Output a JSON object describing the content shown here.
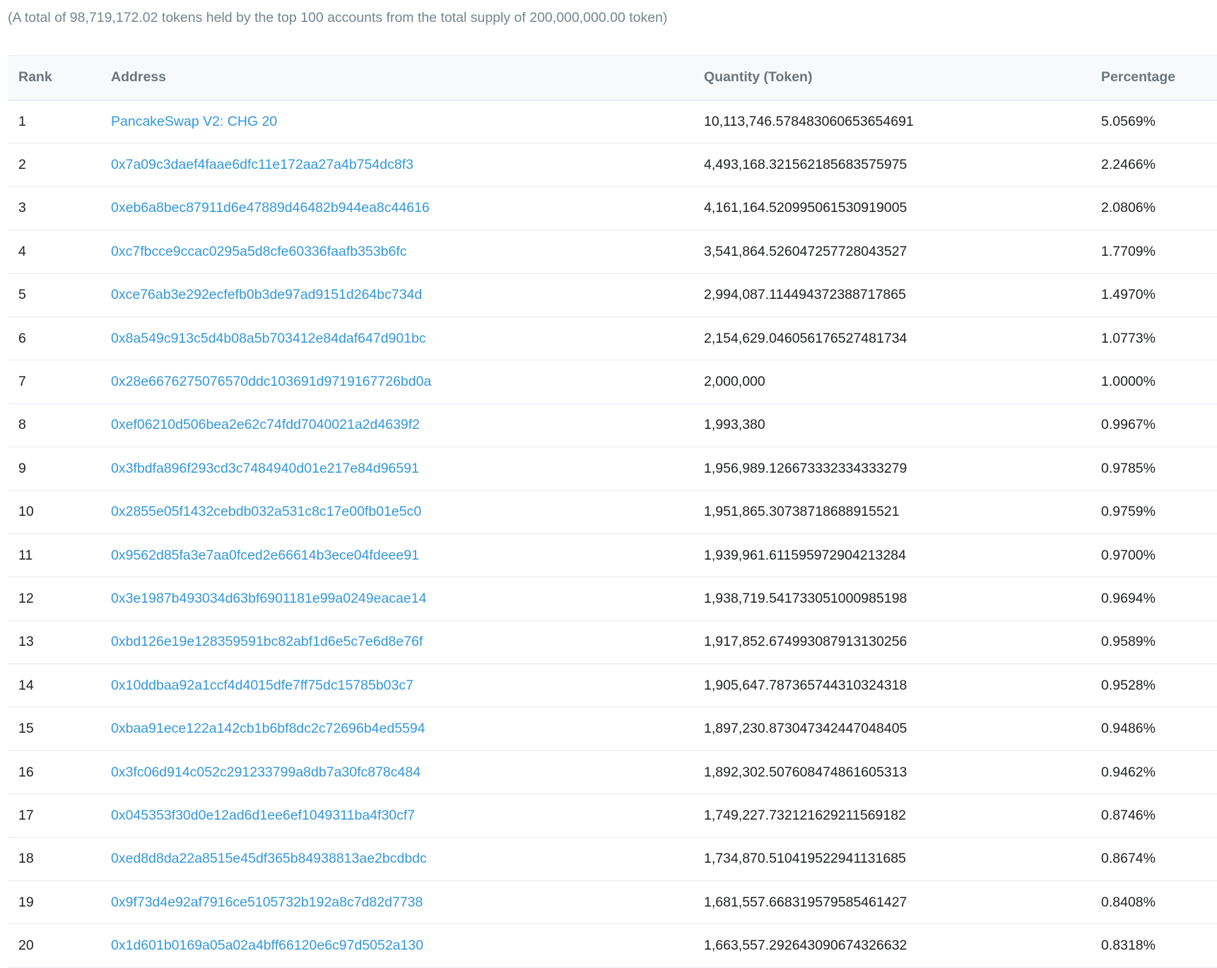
{
  "summary": "(A total of 98,719,172.02 tokens held by the top 100 accounts from the total supply of 200,000,000.00 token)",
  "columns": {
    "rank": "Rank",
    "address": "Address",
    "quantity": "Quantity (Token)",
    "percentage": "Percentage"
  },
  "colors": {
    "link": "#3498db",
    "header_bg": "#f8f9fa",
    "muted_text": "#77838f",
    "border": "#e7eaf3"
  },
  "rows": [
    {
      "rank": "1",
      "address": "PancakeSwap V2: CHG 20",
      "quantity": "10,113,746.578483060653654691",
      "percentage": "5.0569%"
    },
    {
      "rank": "2",
      "address": "0x7a09c3daef4faae6dfc11e172aa27a4b754dc8f3",
      "quantity": "4,493,168.321562185683575975",
      "percentage": "2.2466%"
    },
    {
      "rank": "3",
      "address": "0xeb6a8bec87911d6e47889d46482b944ea8c44616",
      "quantity": "4,161,164.520995061530919005",
      "percentage": "2.0806%"
    },
    {
      "rank": "4",
      "address": "0xc7fbcce9ccac0295a5d8cfe60336faafb353b6fc",
      "quantity": "3,541,864.526047257728043527",
      "percentage": "1.7709%"
    },
    {
      "rank": "5",
      "address": "0xce76ab3e292ecfefb0b3de97ad9151d264bc734d",
      "quantity": "2,994,087.114494372388717865",
      "percentage": "1.4970%"
    },
    {
      "rank": "6",
      "address": "0x8a549c913c5d4b08a5b703412e84daf647d901bc",
      "quantity": "2,154,629.046056176527481734",
      "percentage": "1.0773%"
    },
    {
      "rank": "7",
      "address": "0x28e6676275076570ddc103691d9719167726bd0a",
      "quantity": "2,000,000",
      "percentage": "1.0000%"
    },
    {
      "rank": "8",
      "address": "0xef06210d506bea2e62c74fdd7040021a2d4639f2",
      "quantity": "1,993,380",
      "percentage": "0.9967%"
    },
    {
      "rank": "9",
      "address": "0x3fbdfa896f293cd3c7484940d01e217e84d96591",
      "quantity": "1,956,989.126673332334333279",
      "percentage": "0.9785%"
    },
    {
      "rank": "10",
      "address": "0x2855e05f1432cebdb032a531c8c17e00fb01e5c0",
      "quantity": "1,951,865.30738718688915521",
      "percentage": "0.9759%"
    },
    {
      "rank": "11",
      "address": "0x9562d85fa3e7aa0fced2e66614b3ece04fdeee91",
      "quantity": "1,939,961.611595972904213284",
      "percentage": "0.9700%"
    },
    {
      "rank": "12",
      "address": "0x3e1987b493034d63bf6901181e99a0249eacae14",
      "quantity": "1,938,719.541733051000985198",
      "percentage": "0.9694%"
    },
    {
      "rank": "13",
      "address": "0xbd126e19e128359591bc82abf1d6e5c7e6d8e76f",
      "quantity": "1,917,852.674993087913130256",
      "percentage": "0.9589%"
    },
    {
      "rank": "14",
      "address": "0x10ddbaa92a1ccf4d4015dfe7ff75dc15785b03c7",
      "quantity": "1,905,647.787365744310324318",
      "percentage": "0.9528%"
    },
    {
      "rank": "15",
      "address": "0xbaa91ece122a142cb1b6bf8dc2c72696b4ed5594",
      "quantity": "1,897,230.873047342447048405",
      "percentage": "0.9486%"
    },
    {
      "rank": "16",
      "address": "0x3fc06d914c052c291233799a8db7a30fc878c484",
      "quantity": "1,892,302.507608474861605313",
      "percentage": "0.9462%"
    },
    {
      "rank": "17",
      "address": "0x045353f30d0e12ad6d1ee6ef1049311ba4f30cf7",
      "quantity": "1,749,227.732121629211569182",
      "percentage": "0.8746%"
    },
    {
      "rank": "18",
      "address": "0xed8d8da22a8515e45df365b84938813ae2bcdbdc",
      "quantity": "1,734,870.510419522941131685",
      "percentage": "0.8674%"
    },
    {
      "rank": "19",
      "address": "0x9f73d4e92af7916ce5105732b192a8c7d82d7738",
      "quantity": "1,681,557.668319579585461427",
      "percentage": "0.8408%"
    },
    {
      "rank": "20",
      "address": "0x1d601b0169a05a02a4bff66120e6c97d5052a130",
      "quantity": "1,663,557.292643090674326632",
      "percentage": "0.8318%"
    }
  ]
}
